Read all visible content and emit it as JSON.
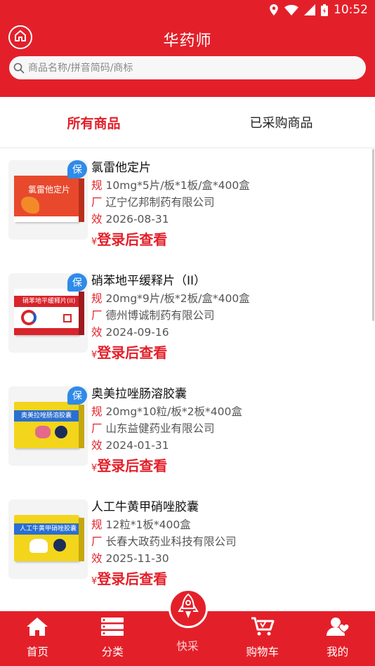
{
  "status_bar": {
    "time": "10:52"
  },
  "header": {
    "title": "华药师"
  },
  "search": {
    "placeholder": "商品名称/拼音简码/商标"
  },
  "tabs": [
    {
      "label": "所有商品",
      "active": true
    },
    {
      "label": "已采购商品",
      "active": false
    }
  ],
  "field_labels": {
    "spec": "规",
    "maker": "厂",
    "expiry": "效"
  },
  "badge_label": "保",
  "currency": "¥",
  "products": [
    {
      "name": "氯雷他定片",
      "spec": "10mg*5片/板*1板/盒*400盒",
      "maker": "辽宁亿邦制药有限公司",
      "expiry": "2026-08-31",
      "price": "登录后查看",
      "badge": true,
      "box_text": "氯雷他定片",
      "box_color": "#e8492d"
    },
    {
      "name": "硝苯地平缓释片（II）",
      "spec": "20mg*9片/板*2板/盒*400盒",
      "maker": "德州博诚制药有限公司",
      "expiry": "2024-09-16",
      "price": "登录后查看",
      "badge": true,
      "box_text": "硝苯地平缓释片(II)",
      "box_color": "#d8242b"
    },
    {
      "name": "奥美拉唑肠溶胶囊",
      "spec": "20mg*10粒/板*2板*400盒",
      "maker": "山东益健药业有限公司",
      "expiry": "2024-01-31",
      "price": "登录后查看",
      "badge": true,
      "box_text": "奥美拉唑肠溶胶囊",
      "box_color": "#f3d51c"
    },
    {
      "name": "人工牛黄甲硝唑胶囊",
      "spec": "12粒*1板*400盒",
      "maker": "长春大政药业科技有限公司",
      "expiry": "2025-11-30",
      "price": "登录后查看",
      "badge": false,
      "box_text": "人工牛黄甲硝唑胶囊",
      "box_color": "#f3d51c"
    }
  ],
  "tabbar": [
    {
      "label": "首页",
      "icon": "home-icon"
    },
    {
      "label": "分类",
      "icon": "category-icon"
    },
    {
      "label": "快采",
      "icon": "rocket-icon"
    },
    {
      "label": "购物车",
      "icon": "cart-icon"
    },
    {
      "label": "我的",
      "icon": "user-icon"
    }
  ],
  "colors": {
    "brand": "#e3202a",
    "badge": "#2f8be8"
  }
}
